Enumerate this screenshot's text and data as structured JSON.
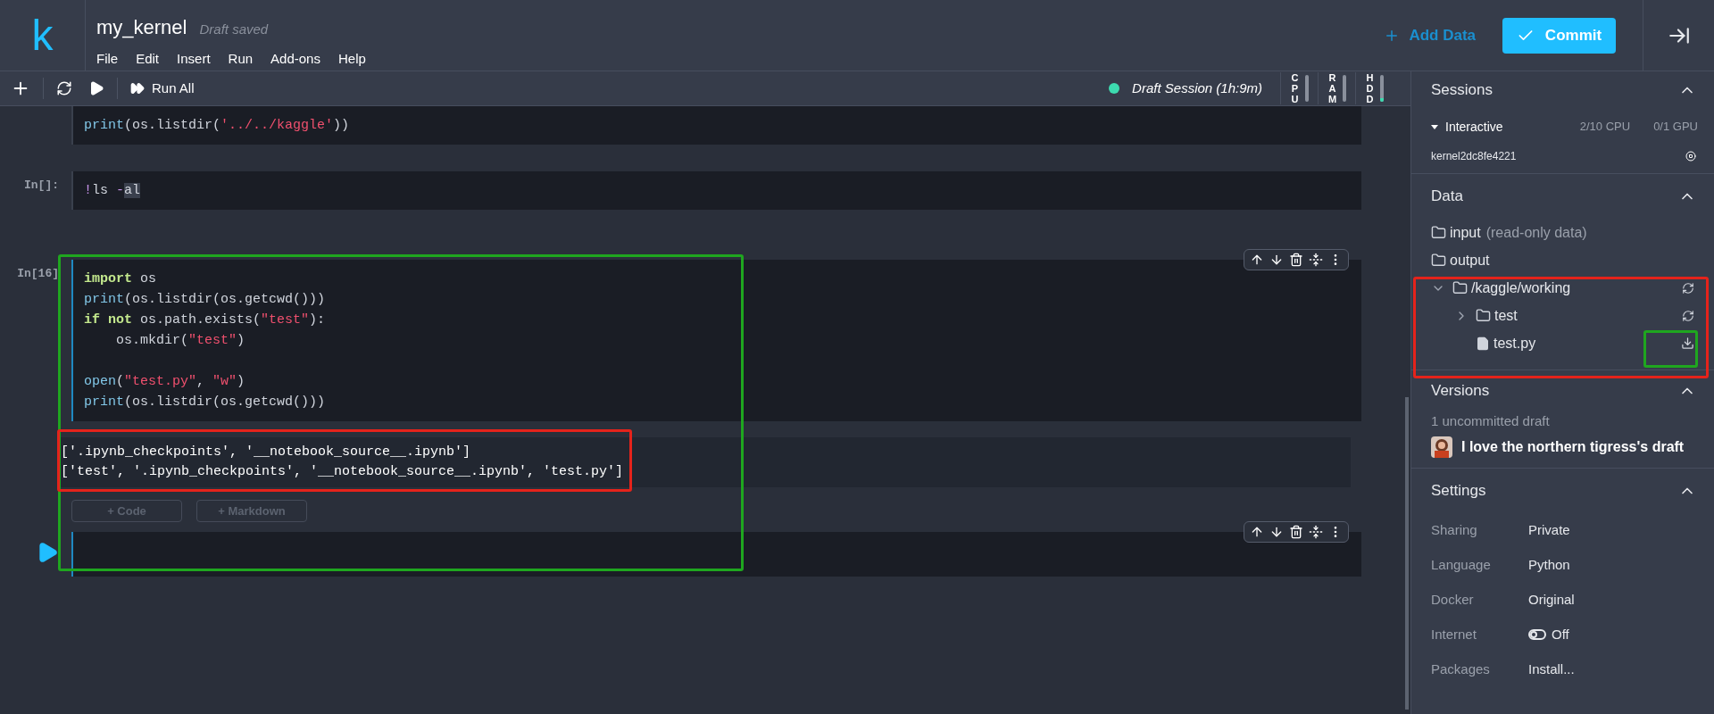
{
  "header": {
    "logo": "k",
    "title": "my_kernel",
    "status": "Draft saved",
    "menu": [
      "File",
      "Edit",
      "Insert",
      "Run",
      "Add-ons",
      "Help"
    ],
    "add_data": "Add Data",
    "commit": "Commit"
  },
  "toolbar": {
    "run_all": "Run All",
    "session": {
      "label": "Draft Session (1h:9m)",
      "color": "#3ddbb0"
    },
    "meters": [
      {
        "label": "CPU"
      },
      {
        "label": "RAM"
      },
      {
        "label": "HDD",
        "level": 0.15
      }
    ]
  },
  "cells": [
    {
      "kind": "code",
      "lines": [
        {
          "tokens": [
            {
              "kind": "fn",
              "text": "print"
            },
            {
              "kind": "p",
              "text": "(os.listdir("
            },
            {
              "kind": "str",
              "text": "'../../kaggle'"
            },
            {
              "kind": "p",
              "text": "))"
            }
          ]
        }
      ]
    },
    {
      "kind": "code",
      "prompt": "In[]:",
      "lines": [
        {
          "tokens": [
            {
              "kind": "op",
              "text": "!"
            },
            {
              "kind": "p",
              "text": "ls "
            },
            {
              "kind": "op",
              "text": "-"
            },
            {
              "kind": "sel",
              "text": "al"
            }
          ]
        }
      ]
    },
    {
      "kind": "code",
      "prompt": "In[16]",
      "toolbar": true,
      "lines": [
        {
          "tokens": [
            {
              "kind": "kw",
              "text": "import"
            },
            {
              "kind": "p",
              "text": " os"
            }
          ]
        },
        {
          "tokens": [
            {
              "kind": "fn",
              "text": "print"
            },
            {
              "kind": "p",
              "text": "(os.listdir(os.getcwd()))"
            }
          ]
        },
        {
          "tokens": [
            {
              "kind": "kw",
              "text": "if not"
            },
            {
              "kind": "p",
              "text": " os.path.exists("
            },
            {
              "kind": "str",
              "text": "\"test\""
            },
            {
              "kind": "p",
              "text": "):"
            }
          ]
        },
        {
          "tokens": [
            {
              "kind": "p",
              "text": "    os.mkdir("
            },
            {
              "kind": "str",
              "text": "\"test\""
            },
            {
              "kind": "p",
              "text": ")"
            }
          ]
        },
        {
          "space_before": true,
          "tokens": [
            {
              "kind": "fn",
              "text": "open"
            },
            {
              "kind": "p",
              "text": "("
            },
            {
              "kind": "str",
              "text": "\"test.py\""
            },
            {
              "kind": "p",
              "text": ", "
            },
            {
              "kind": "str",
              "text": "\"w\""
            },
            {
              "kind": "p",
              "text": ")"
            }
          ]
        },
        {
          "tokens": [
            {
              "kind": "fn",
              "text": "print"
            },
            {
              "kind": "p",
              "text": "(os.listdir(os.getcwd()))"
            }
          ]
        }
      ]
    },
    {
      "kind": "output",
      "lines": [
        "['.ipynb_checkpoints', '__notebook_source__.ipynb']",
        "['test', '.ipynb_checkpoints', '__notebook_source__.ipynb', 'test.py']"
      ]
    },
    {
      "kind": "add",
      "buttons": [
        "+ Code",
        "+ Markdown"
      ]
    },
    {
      "kind": "code",
      "toolbar": true,
      "active": true
    }
  ],
  "sidebar": {
    "sessions": {
      "title": "Sessions",
      "name": "Interactive",
      "cpu": "2/10 CPU",
      "gpu": "0/1 GPU",
      "kernel": "kernel2dc8fe4221"
    },
    "data": {
      "title": "Data",
      "items": [
        {
          "kind": "folder",
          "name": "input",
          "note": "(read-only data)"
        },
        {
          "kind": "folder",
          "name": "output"
        },
        {
          "kind": "folder",
          "name": "/kaggle/working",
          "expanded": true,
          "children": [
            {
              "kind": "folder",
              "name": "test",
              "expanded": false
            },
            {
              "kind": "file",
              "name": "test.py"
            }
          ]
        }
      ]
    },
    "versions": {
      "title": "Versions",
      "count": "1 uncommitted draft",
      "draft": "I love the northern tigress's draft"
    },
    "settings": {
      "title": "Settings",
      "rows": [
        {
          "label": "Sharing",
          "value": "Private"
        },
        {
          "label": "Language",
          "value": "Python"
        },
        {
          "label": "Docker",
          "value": "Original"
        },
        {
          "label": "Internet",
          "value": "Off",
          "kind": "toggle",
          "on": false
        },
        {
          "label": "Packages",
          "value": "Install..."
        }
      ]
    }
  },
  "annotations": [
    {
      "color": "#1fa61f"
    },
    {
      "color": "#e5231b"
    },
    {
      "color": "#e5231b"
    },
    {
      "color": "#1fa61f"
    }
  ]
}
